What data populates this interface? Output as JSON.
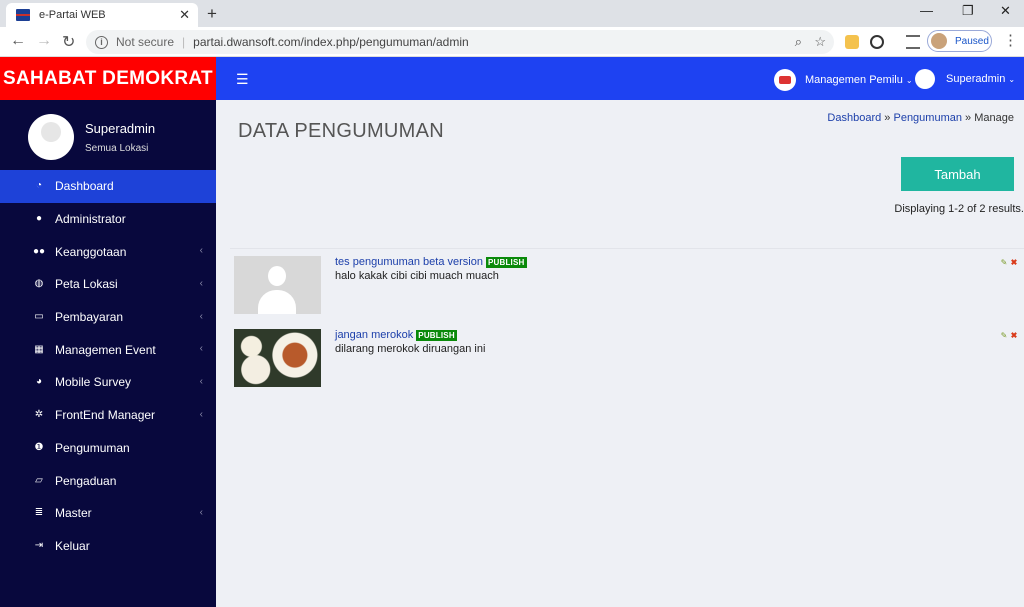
{
  "browser": {
    "tab_title": "e-Partai WEB",
    "not_secure": "Not secure",
    "url": "partai.dwansoft.com/index.php/pengumuman/admin",
    "paused_label": "Paused"
  },
  "app": {
    "brand": "SAHABAT DEMOKRAT",
    "user": {
      "name": "Superadmin",
      "location": "Semua Lokasi"
    },
    "topbar": {
      "menu1": "Managemen Pemilu",
      "menu2": "Superadmin"
    },
    "colors": {
      "brand": "#ff0000",
      "sidebar": "#08083d",
      "topbar": "#1e42f2",
      "active": "#1e42d8",
      "add_button": "#20b6a0",
      "badge": "#0a8a0a"
    }
  },
  "sidebar": {
    "items": [
      {
        "label": "Dashboard",
        "icon": "dashboard-icon"
      },
      {
        "label": "Administrator",
        "icon": "user-icon"
      },
      {
        "label": "Keanggotaan",
        "icon": "users-icon"
      },
      {
        "label": "Peta Lokasi",
        "icon": "globe-icon"
      },
      {
        "label": "Pembayaran",
        "icon": "money-icon"
      },
      {
        "label": "Managemen Event",
        "icon": "calendar-icon"
      },
      {
        "label": "Mobile Survey",
        "icon": "pie-chart-icon"
      },
      {
        "label": "FrontEnd Manager",
        "icon": "gear-icon"
      },
      {
        "label": "Pengumuman",
        "icon": "info-icon"
      },
      {
        "label": "Pengaduan",
        "icon": "inbox-icon"
      },
      {
        "label": "Master",
        "icon": "database-icon"
      },
      {
        "label": "Keluar",
        "icon": "sign-out-icon"
      }
    ]
  },
  "main": {
    "title": "DATA PENGUMUMAN",
    "breadcrumb": {
      "link1": "Dashboard",
      "sep": "»",
      "link2": "Pengumuman",
      "current": "Manage"
    },
    "add_button": "Tambah",
    "summary": "Displaying 1-2 of 2 results.",
    "announcements": [
      {
        "title": "tes pengumuman beta version",
        "status": "PUBLISH",
        "desc": "halo kakak cibi cibi muach muach"
      },
      {
        "title": "jangan merokok",
        "status": "PUBLISH",
        "desc": "dilarang merokok diruangan ini"
      }
    ]
  }
}
